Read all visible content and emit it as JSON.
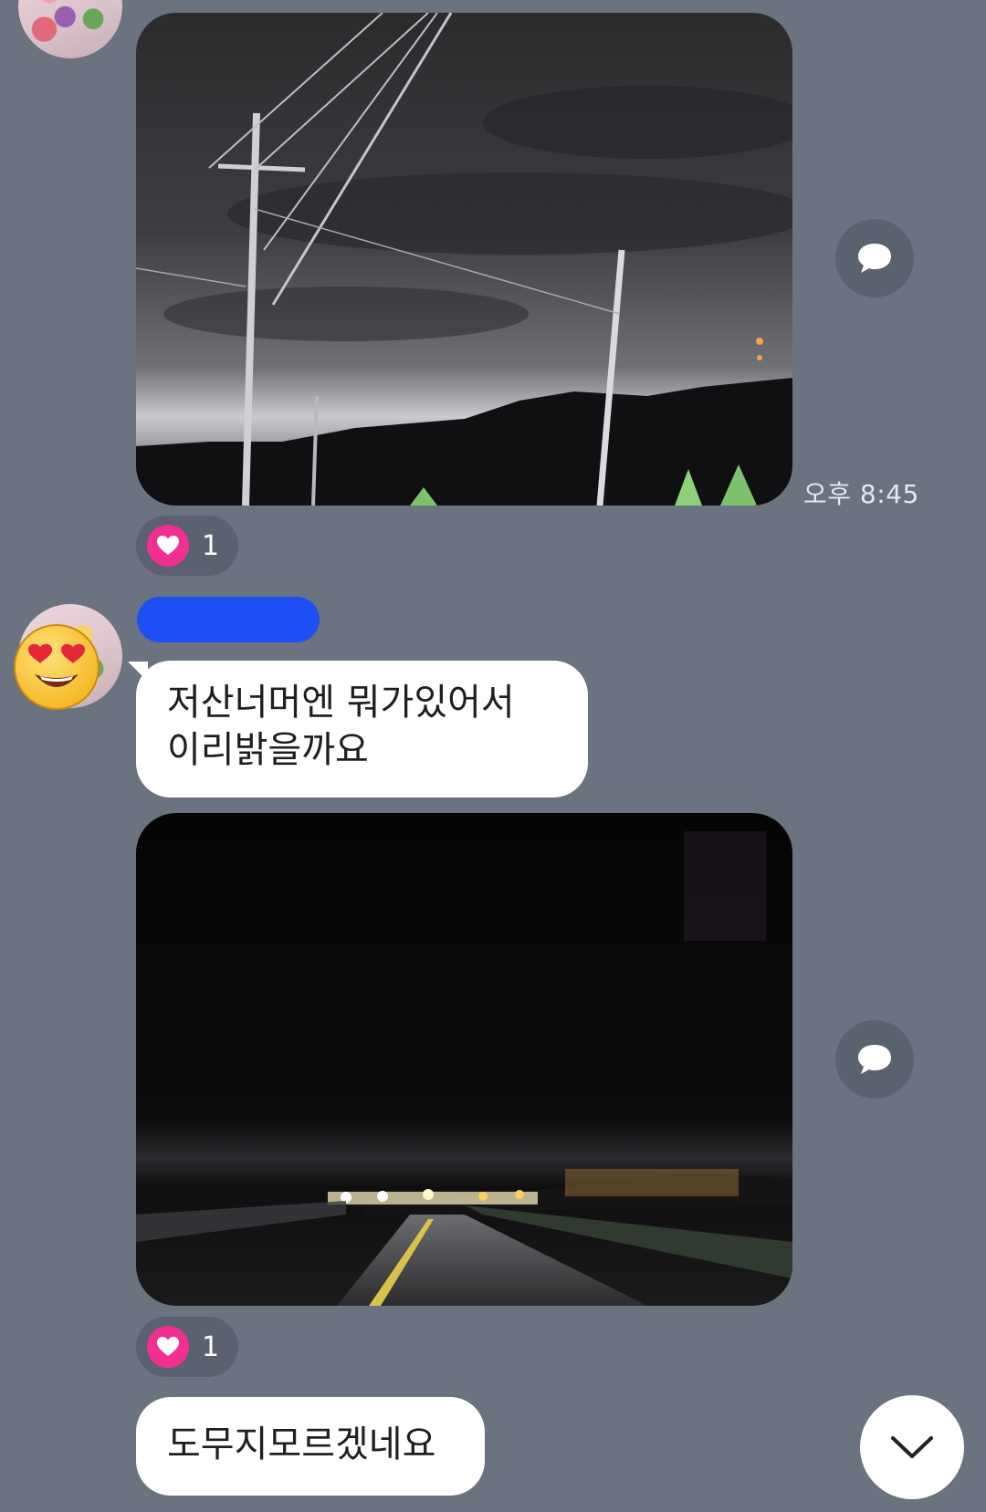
{
  "messages": {
    "photo1": {
      "time": "오후 8:45",
      "reaction_count": "1"
    },
    "text1": {
      "line1": "저산너머엔 뭐가있어서",
      "line2": "이리밝을까요"
    },
    "photo2": {
      "reaction_count": "1"
    },
    "text2": {
      "text": "도무지모르겠네요"
    }
  },
  "icons": {
    "share": "speech-bubble-icon",
    "reaction": "heart-icon",
    "scroll": "chevron-down-icon",
    "avatar_emoji": "heart-eyes-emoji-icon"
  },
  "colors": {
    "background": "#6b7280",
    "bubble": "#ffffff",
    "reaction_heart": "#f0308f",
    "name_redaction": "#1d4ff5"
  }
}
